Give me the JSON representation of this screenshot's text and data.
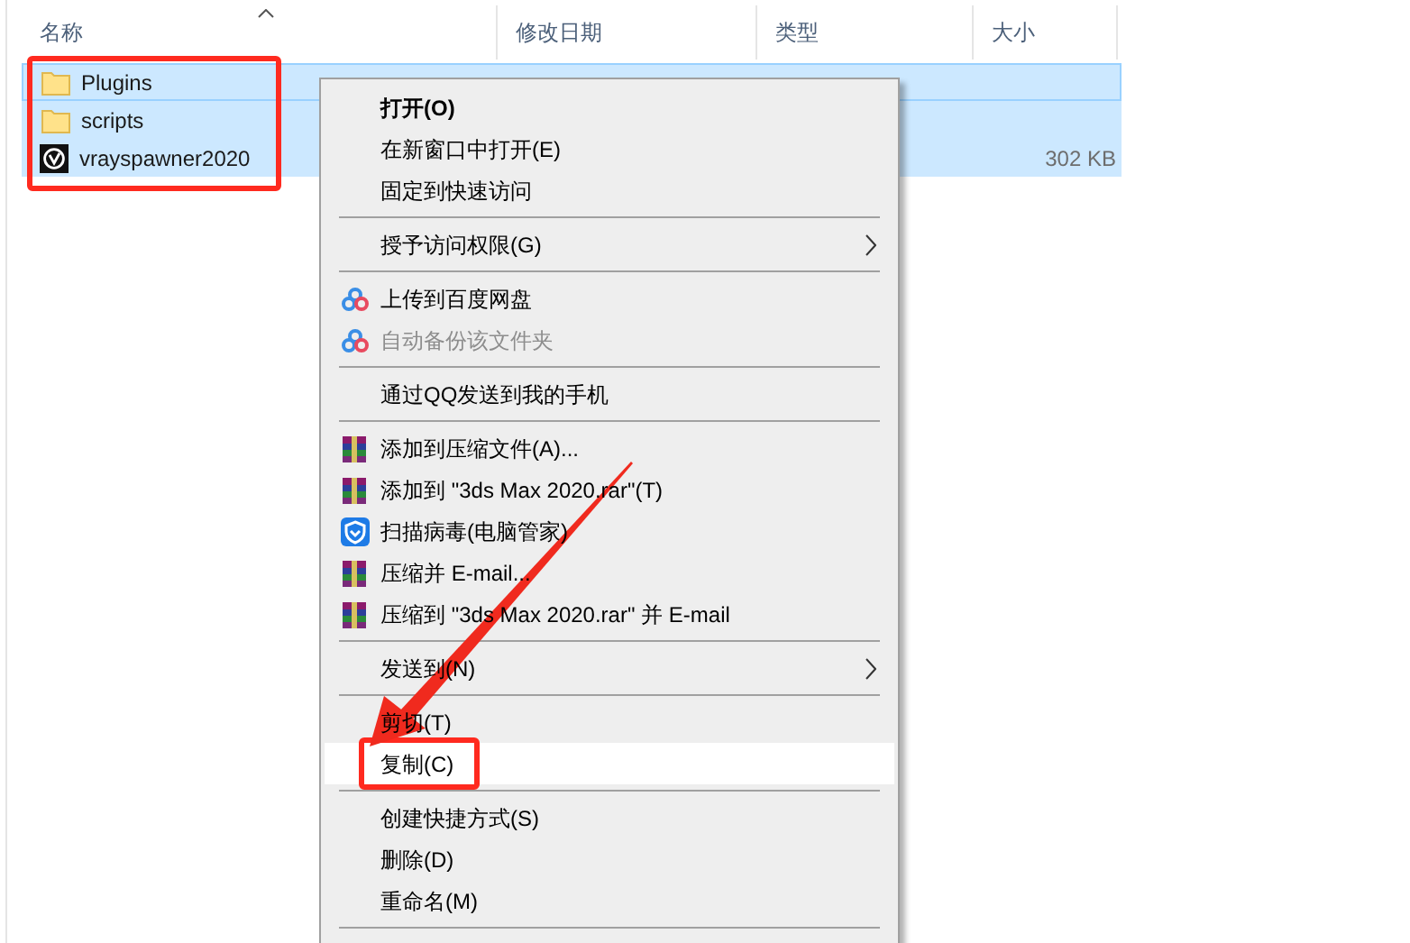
{
  "columns": [
    {
      "label": "名称",
      "sorted": true
    },
    {
      "label": "修改日期"
    },
    {
      "label": "类型"
    },
    {
      "label": "大小"
    }
  ],
  "rows": [
    {
      "name": "Plugins",
      "kind": "folder",
      "size": "",
      "selected": true,
      "focused": true
    },
    {
      "name": "scripts",
      "kind": "folder",
      "size": "",
      "selected": true,
      "focused": false
    },
    {
      "name": "vrayspawner2020",
      "kind": "app",
      "size": "302 KB",
      "selected": true,
      "focused": false
    }
  ],
  "context_menu": [
    {
      "kind": "plain",
      "label": "打开(O)",
      "bold": true,
      "disabled": false,
      "highlighted": false
    },
    {
      "kind": "plain",
      "label": "在新窗口中打开(E)",
      "disabled": false,
      "highlighted": false
    },
    {
      "kind": "plain",
      "label": "固定到快速访问",
      "disabled": false,
      "highlighted": false
    },
    {
      "kind": "separator"
    },
    {
      "kind": "plain",
      "label": "授予访问权限(G)",
      "submenu": true,
      "disabled": false,
      "highlighted": false
    },
    {
      "kind": "separator"
    },
    {
      "kind": "cloud",
      "label": "上传到百度网盘",
      "disabled": false,
      "highlighted": false
    },
    {
      "kind": "cloud",
      "label": "自动备份该文件夹",
      "disabled": true,
      "highlighted": false
    },
    {
      "kind": "separator"
    },
    {
      "kind": "plain",
      "label": "通过QQ发送到我的手机",
      "disabled": false,
      "highlighted": false
    },
    {
      "kind": "separator"
    },
    {
      "kind": "archive",
      "label": "添加到压缩文件(A)...",
      "disabled": false,
      "highlighted": false
    },
    {
      "kind": "archive",
      "label": "添加到 \"3ds Max 2020.rar\"(T)",
      "disabled": false,
      "highlighted": false
    },
    {
      "kind": "shield",
      "label": "扫描病毒(电脑管家)",
      "disabled": false,
      "highlighted": false
    },
    {
      "kind": "archive",
      "label": "压缩并 E-mail...",
      "disabled": false,
      "highlighted": false
    },
    {
      "kind": "archive",
      "label": "压缩到 \"3ds Max 2020.rar\" 并 E-mail",
      "disabled": false,
      "highlighted": false
    },
    {
      "kind": "separator"
    },
    {
      "kind": "plain",
      "label": "发送到(N)",
      "submenu": true,
      "disabled": false,
      "highlighted": false
    },
    {
      "kind": "separator"
    },
    {
      "kind": "plain",
      "label": "剪切(T)",
      "disabled": false,
      "highlighted": false
    },
    {
      "kind": "plain",
      "label": "复制(C)",
      "disabled": false,
      "highlighted": true
    },
    {
      "kind": "separator"
    },
    {
      "kind": "plain",
      "label": "创建快捷方式(S)",
      "disabled": false,
      "highlighted": false
    },
    {
      "kind": "plain",
      "label": "删除(D)",
      "disabled": false,
      "highlighted": false
    },
    {
      "kind": "plain",
      "label": "重命名(M)",
      "disabled": false,
      "highlighted": false
    },
    {
      "kind": "separator"
    }
  ]
}
